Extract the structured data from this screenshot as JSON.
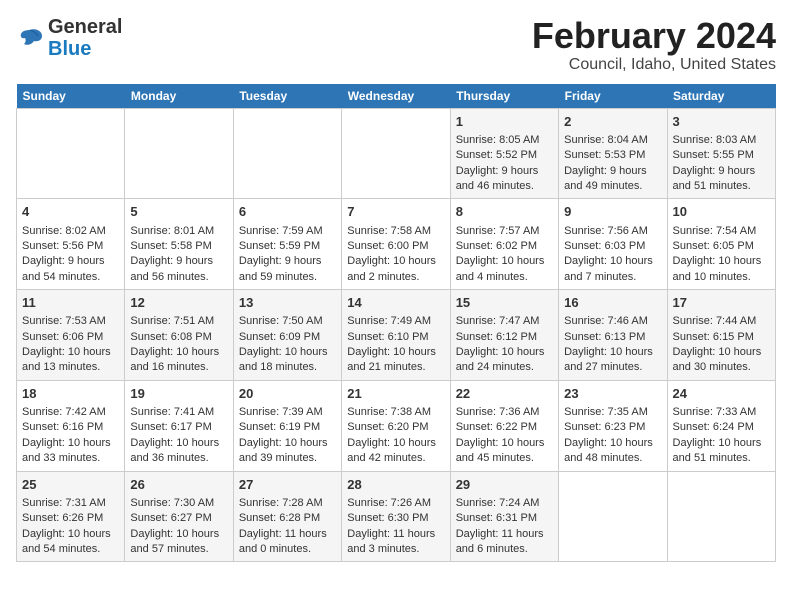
{
  "header": {
    "logo_general": "General",
    "logo_blue": "Blue",
    "title": "February 2024",
    "subtitle": "Council, Idaho, United States"
  },
  "days_of_week": [
    "Sunday",
    "Monday",
    "Tuesday",
    "Wednesday",
    "Thursday",
    "Friday",
    "Saturday"
  ],
  "weeks": [
    [
      {
        "day": "",
        "empty": true
      },
      {
        "day": "",
        "empty": true
      },
      {
        "day": "",
        "empty": true
      },
      {
        "day": "",
        "empty": true
      },
      {
        "day": "1",
        "lines": [
          "Sunrise: 8:05 AM",
          "Sunset: 5:52 PM",
          "Daylight: 9 hours",
          "and 46 minutes."
        ]
      },
      {
        "day": "2",
        "lines": [
          "Sunrise: 8:04 AM",
          "Sunset: 5:53 PM",
          "Daylight: 9 hours",
          "and 49 minutes."
        ]
      },
      {
        "day": "3",
        "lines": [
          "Sunrise: 8:03 AM",
          "Sunset: 5:55 PM",
          "Daylight: 9 hours",
          "and 51 minutes."
        ]
      }
    ],
    [
      {
        "day": "4",
        "lines": [
          "Sunrise: 8:02 AM",
          "Sunset: 5:56 PM",
          "Daylight: 9 hours",
          "and 54 minutes."
        ]
      },
      {
        "day": "5",
        "lines": [
          "Sunrise: 8:01 AM",
          "Sunset: 5:58 PM",
          "Daylight: 9 hours",
          "and 56 minutes."
        ]
      },
      {
        "day": "6",
        "lines": [
          "Sunrise: 7:59 AM",
          "Sunset: 5:59 PM",
          "Daylight: 9 hours",
          "and 59 minutes."
        ]
      },
      {
        "day": "7",
        "lines": [
          "Sunrise: 7:58 AM",
          "Sunset: 6:00 PM",
          "Daylight: 10 hours",
          "and 2 minutes."
        ]
      },
      {
        "day": "8",
        "lines": [
          "Sunrise: 7:57 AM",
          "Sunset: 6:02 PM",
          "Daylight: 10 hours",
          "and 4 minutes."
        ]
      },
      {
        "day": "9",
        "lines": [
          "Sunrise: 7:56 AM",
          "Sunset: 6:03 PM",
          "Daylight: 10 hours",
          "and 7 minutes."
        ]
      },
      {
        "day": "10",
        "lines": [
          "Sunrise: 7:54 AM",
          "Sunset: 6:05 PM",
          "Daylight: 10 hours",
          "and 10 minutes."
        ]
      }
    ],
    [
      {
        "day": "11",
        "lines": [
          "Sunrise: 7:53 AM",
          "Sunset: 6:06 PM",
          "Daylight: 10 hours",
          "and 13 minutes."
        ]
      },
      {
        "day": "12",
        "lines": [
          "Sunrise: 7:51 AM",
          "Sunset: 6:08 PM",
          "Daylight: 10 hours",
          "and 16 minutes."
        ]
      },
      {
        "day": "13",
        "lines": [
          "Sunrise: 7:50 AM",
          "Sunset: 6:09 PM",
          "Daylight: 10 hours",
          "and 18 minutes."
        ]
      },
      {
        "day": "14",
        "lines": [
          "Sunrise: 7:49 AM",
          "Sunset: 6:10 PM",
          "Daylight: 10 hours",
          "and 21 minutes."
        ]
      },
      {
        "day": "15",
        "lines": [
          "Sunrise: 7:47 AM",
          "Sunset: 6:12 PM",
          "Daylight: 10 hours",
          "and 24 minutes."
        ]
      },
      {
        "day": "16",
        "lines": [
          "Sunrise: 7:46 AM",
          "Sunset: 6:13 PM",
          "Daylight: 10 hours",
          "and 27 minutes."
        ]
      },
      {
        "day": "17",
        "lines": [
          "Sunrise: 7:44 AM",
          "Sunset: 6:15 PM",
          "Daylight: 10 hours",
          "and 30 minutes."
        ]
      }
    ],
    [
      {
        "day": "18",
        "lines": [
          "Sunrise: 7:42 AM",
          "Sunset: 6:16 PM",
          "Daylight: 10 hours",
          "and 33 minutes."
        ]
      },
      {
        "day": "19",
        "lines": [
          "Sunrise: 7:41 AM",
          "Sunset: 6:17 PM",
          "Daylight: 10 hours",
          "and 36 minutes."
        ]
      },
      {
        "day": "20",
        "lines": [
          "Sunrise: 7:39 AM",
          "Sunset: 6:19 PM",
          "Daylight: 10 hours",
          "and 39 minutes."
        ]
      },
      {
        "day": "21",
        "lines": [
          "Sunrise: 7:38 AM",
          "Sunset: 6:20 PM",
          "Daylight: 10 hours",
          "and 42 minutes."
        ]
      },
      {
        "day": "22",
        "lines": [
          "Sunrise: 7:36 AM",
          "Sunset: 6:22 PM",
          "Daylight: 10 hours",
          "and 45 minutes."
        ]
      },
      {
        "day": "23",
        "lines": [
          "Sunrise: 7:35 AM",
          "Sunset: 6:23 PM",
          "Daylight: 10 hours",
          "and 48 minutes."
        ]
      },
      {
        "day": "24",
        "lines": [
          "Sunrise: 7:33 AM",
          "Sunset: 6:24 PM",
          "Daylight: 10 hours",
          "and 51 minutes."
        ]
      }
    ],
    [
      {
        "day": "25",
        "lines": [
          "Sunrise: 7:31 AM",
          "Sunset: 6:26 PM",
          "Daylight: 10 hours",
          "and 54 minutes."
        ]
      },
      {
        "day": "26",
        "lines": [
          "Sunrise: 7:30 AM",
          "Sunset: 6:27 PM",
          "Daylight: 10 hours",
          "and 57 minutes."
        ]
      },
      {
        "day": "27",
        "lines": [
          "Sunrise: 7:28 AM",
          "Sunset: 6:28 PM",
          "Daylight: 11 hours",
          "and 0 minutes."
        ]
      },
      {
        "day": "28",
        "lines": [
          "Sunrise: 7:26 AM",
          "Sunset: 6:30 PM",
          "Daylight: 11 hours",
          "and 3 minutes."
        ]
      },
      {
        "day": "29",
        "lines": [
          "Sunrise: 7:24 AM",
          "Sunset: 6:31 PM",
          "Daylight: 11 hours",
          "and 6 minutes."
        ]
      },
      {
        "day": "",
        "empty": true
      },
      {
        "day": "",
        "empty": true
      }
    ]
  ]
}
